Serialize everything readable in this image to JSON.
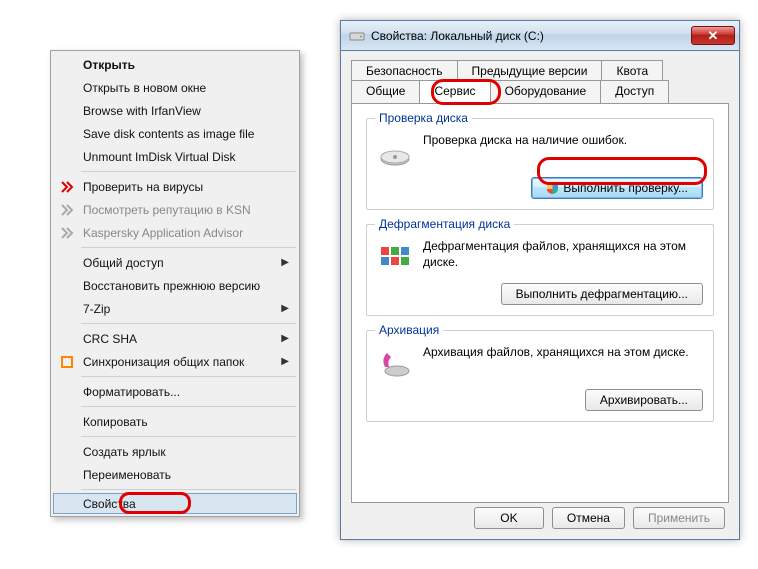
{
  "context_menu": {
    "items": [
      {
        "label": "Открыть",
        "bold": true
      },
      {
        "label": "Открыть в новом окне"
      },
      {
        "label": "Browse with IrfanView"
      },
      {
        "label": "Save disk contents as image file"
      },
      {
        "label": "Unmount ImDisk Virtual Disk"
      },
      {
        "sep": true
      },
      {
        "label": "Проверить на вирусы",
        "icon": "kaspersky-red"
      },
      {
        "label": "Посмотреть репутацию в KSN",
        "icon": "kaspersky-grey",
        "disabled": true
      },
      {
        "label": "Kaspersky Application Advisor",
        "icon": "kaspersky-grey",
        "disabled": true
      },
      {
        "sep": true
      },
      {
        "label": "Общий доступ",
        "submenu": true
      },
      {
        "label": "Восстановить прежнюю версию"
      },
      {
        "label": "7-Zip",
        "submenu": true
      },
      {
        "sep": true
      },
      {
        "label": "CRC SHA",
        "submenu": true
      },
      {
        "label": "Синхронизация общих папок",
        "icon": "sync-orange",
        "submenu": true
      },
      {
        "sep": true
      },
      {
        "label": "Форматировать..."
      },
      {
        "sep": true
      },
      {
        "label": "Копировать"
      },
      {
        "sep": true
      },
      {
        "label": "Создать ярлык"
      },
      {
        "label": "Переименовать"
      },
      {
        "sep": true
      },
      {
        "label": "Свойства",
        "highlighted": true
      }
    ]
  },
  "dialog": {
    "title": "Свойства: Локальный диск (C:)",
    "tabs_row1": [
      "Безопасность",
      "Предыдущие версии",
      "Квота"
    ],
    "tabs_row2": [
      "Общие",
      "Сервис",
      "Оборудование",
      "Доступ"
    ],
    "active_tab": "Сервис",
    "groups": {
      "check": {
        "legend": "Проверка диска",
        "text": "Проверка диска на наличие ошибок.",
        "button": "Выполнить проверку..."
      },
      "defrag": {
        "legend": "Дефрагментация диска",
        "text": "Дефрагментация файлов, хранящихся на этом диске.",
        "button": "Выполнить дефрагментацию..."
      },
      "backup": {
        "legend": "Архивация",
        "text": "Архивация файлов, хранящихся на этом диске.",
        "button": "Архивировать..."
      }
    },
    "footer": {
      "ok": "OK",
      "cancel": "Отмена",
      "apply": "Применить"
    }
  }
}
